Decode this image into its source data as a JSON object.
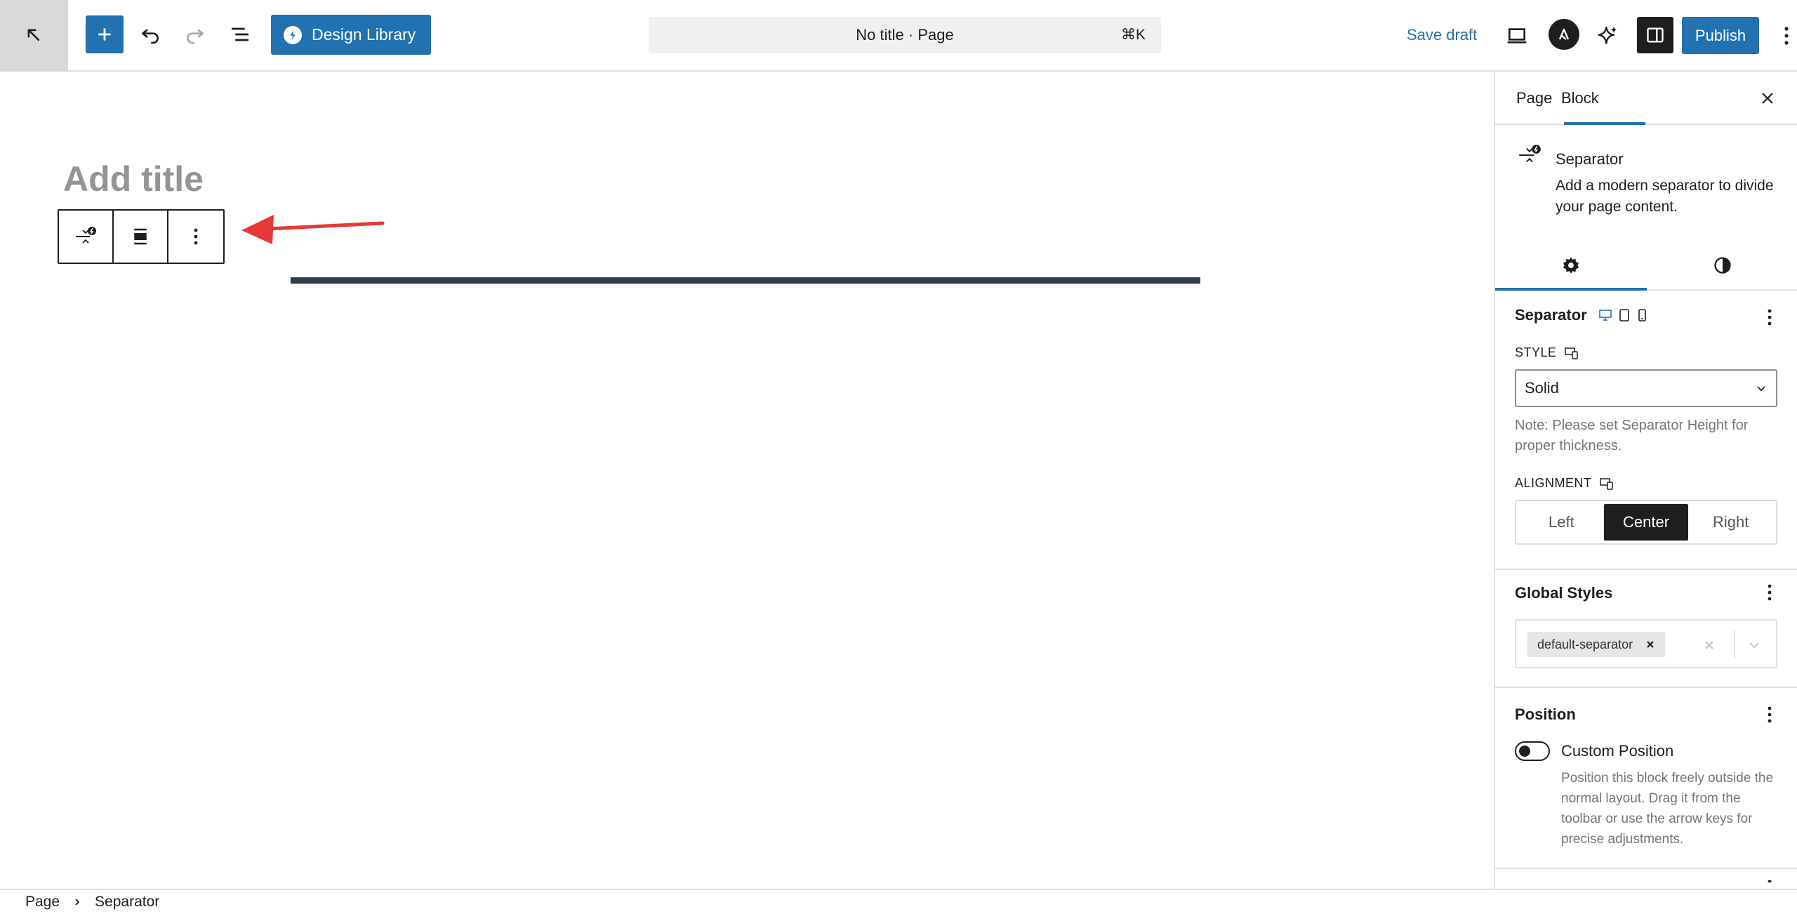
{
  "header": {
    "doc_title": "No title · Page",
    "shortcut": "⌘K",
    "design_library_label": "Design Library",
    "save_draft_label": "Save draft",
    "publish_label": "Publish",
    "accent_color": "#2271b1"
  },
  "editor": {
    "title_placeholder": "Add title",
    "separator_color": "#2c3e50"
  },
  "sidebar": {
    "tabs": [
      {
        "label": "Page",
        "active": false
      },
      {
        "label": "Block",
        "active": true
      }
    ],
    "block_card": {
      "title": "Separator",
      "description": "Add a modern separator to divide your page content."
    },
    "separator_section": {
      "title": "Separator",
      "style_label": "STYLE",
      "style_value": "Solid",
      "note": "Note: Please set Separator Height for proper thickness.",
      "alignment_label": "ALIGNMENT",
      "alignment_options": [
        "Left",
        "Center",
        "Right"
      ],
      "alignment_selected": "Center"
    },
    "global_styles": {
      "title": "Global Styles",
      "tag": "default-separator"
    },
    "position": {
      "title": "Position",
      "toggle_label": "Custom Position",
      "toggle_on": false,
      "help": "Position this block freely outside the normal layout. Drag it from the toolbar or use the arrow keys for precise adjustments."
    }
  },
  "breadcrumb": {
    "items": [
      "Page",
      "Separator"
    ]
  }
}
